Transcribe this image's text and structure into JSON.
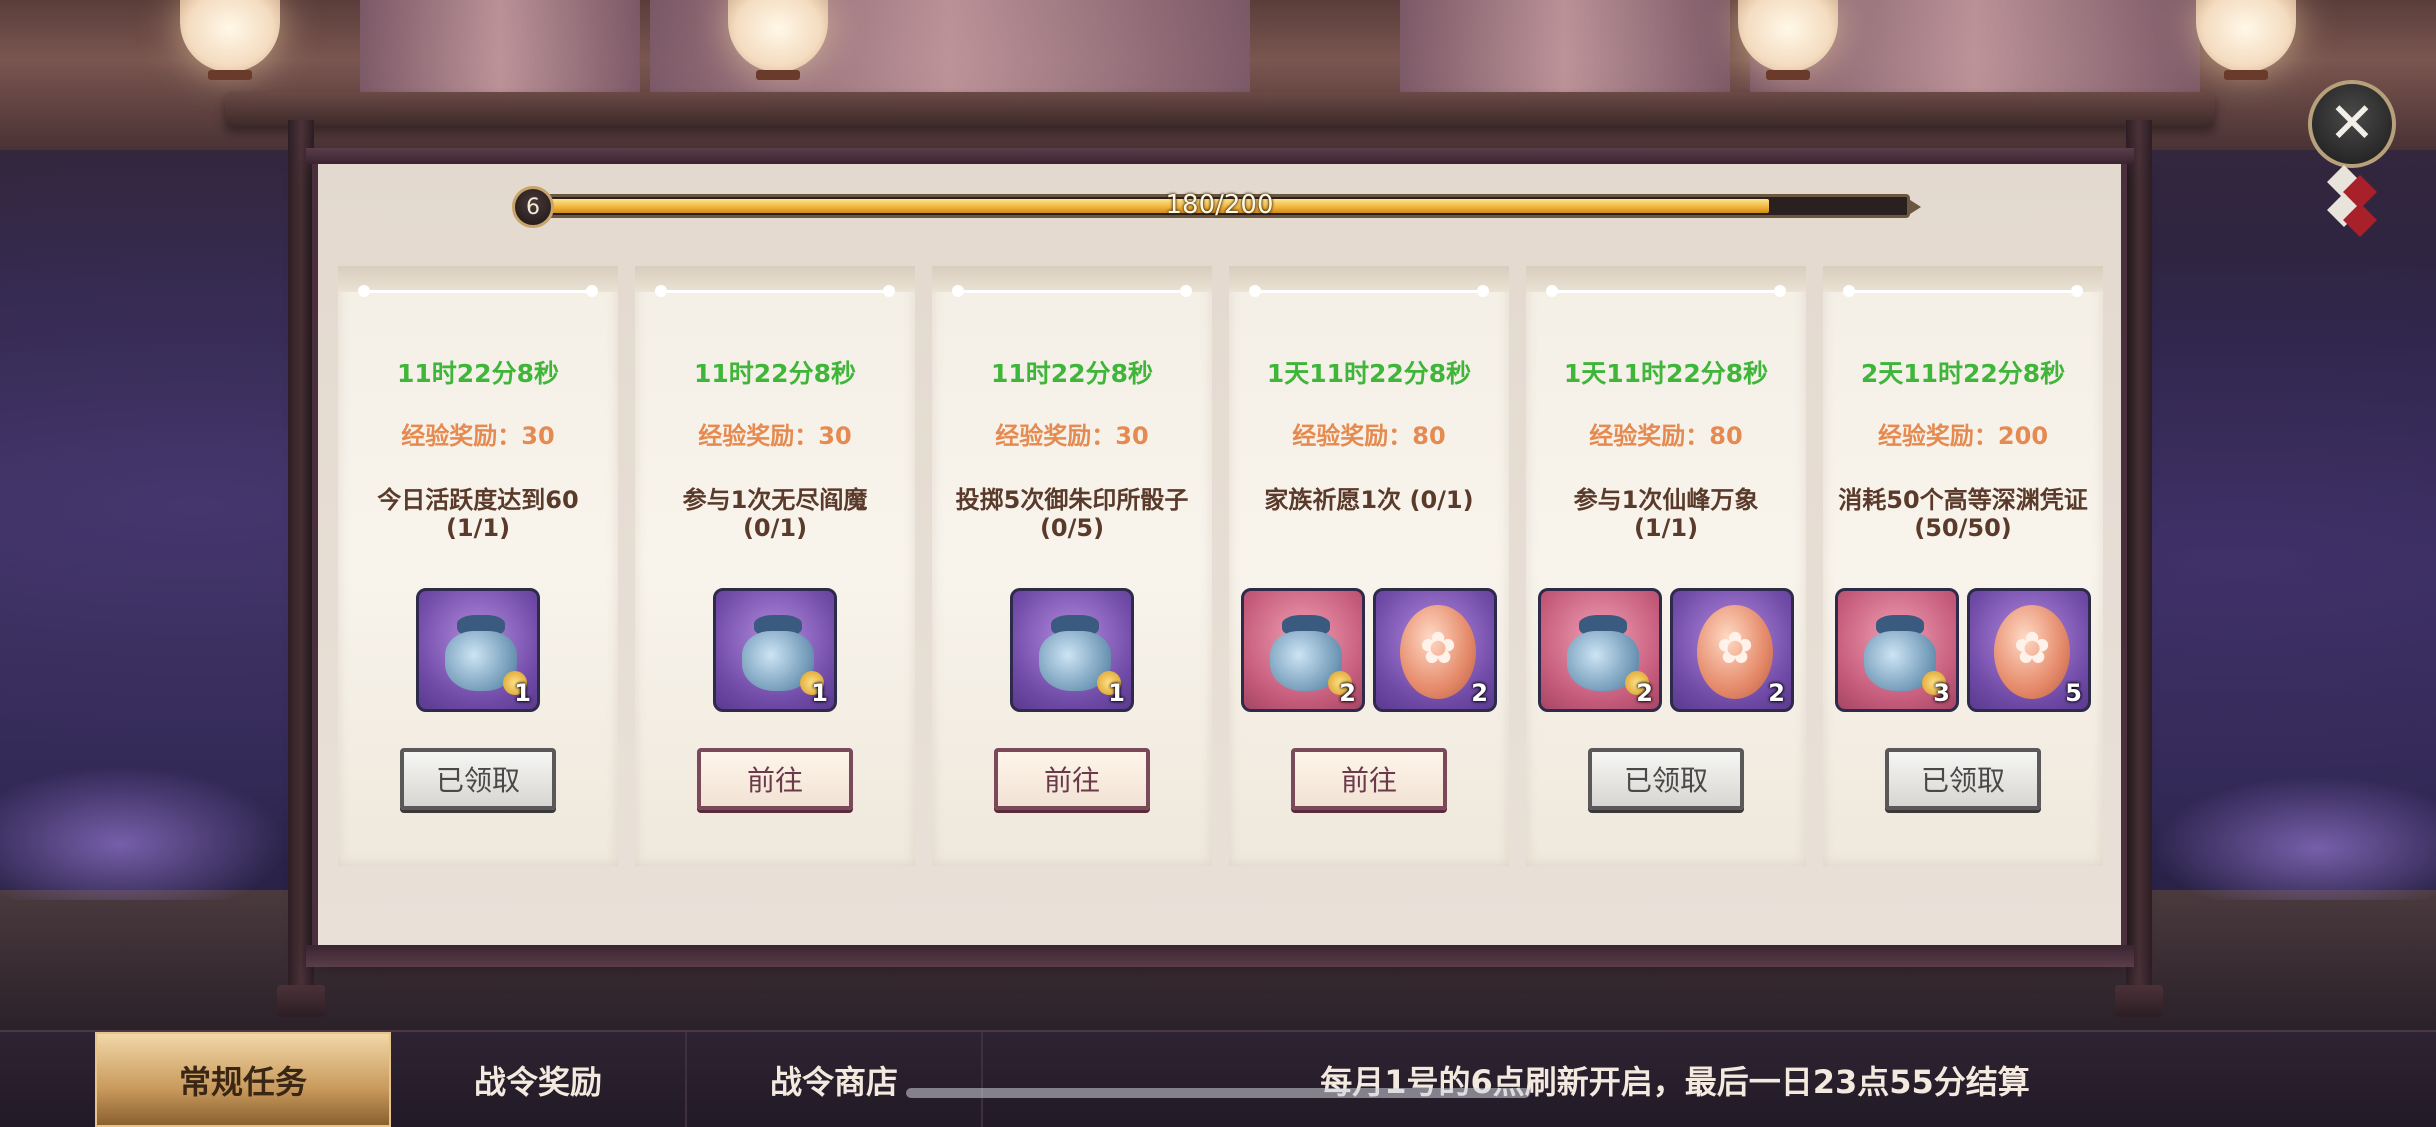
{
  "progress": {
    "level": "6",
    "text": "180/200",
    "fraction": 0.9
  },
  "close_icon": "close-x-icon",
  "cards": [
    {
      "timer": "11时22分8秒",
      "exp": "经验奖励：30",
      "task": "今日活跃度达到60 (1/1)",
      "rewards": [
        {
          "icon": "bag-icon",
          "frame": "purple",
          "qty": "1"
        }
      ],
      "button": "已领取",
      "button_state": "claimed"
    },
    {
      "timer": "11时22分8秒",
      "exp": "经验奖励：30",
      "task": "参与1次无尽阎魔 (0/1)",
      "rewards": [
        {
          "icon": "bag-icon",
          "frame": "purple",
          "qty": "1"
        }
      ],
      "button": "前往",
      "button_state": "goto"
    },
    {
      "timer": "11时22分8秒",
      "exp": "经验奖励：30",
      "task": "投掷5次御朱印所骰子 (0/5)",
      "rewards": [
        {
          "icon": "bag-icon",
          "frame": "purple",
          "qty": "1"
        }
      ],
      "button": "前往",
      "button_state": "goto"
    },
    {
      "timer": "1天11时22分8秒",
      "exp": "经验奖励：80",
      "task": "家族祈愿1次 (0/1)",
      "rewards": [
        {
          "icon": "bag-icon",
          "frame": "pink",
          "qty": "2"
        },
        {
          "icon": "egg-icon",
          "frame": "purple",
          "qty": "2"
        }
      ],
      "button": "前往",
      "button_state": "goto"
    },
    {
      "timer": "1天11时22分8秒",
      "exp": "经验奖励：80",
      "task": "参与1次仙峰万象 (1/1)",
      "rewards": [
        {
          "icon": "bag-icon",
          "frame": "pink",
          "qty": "2"
        },
        {
          "icon": "egg-icon",
          "frame": "purple",
          "qty": "2"
        }
      ],
      "button": "已领取",
      "button_state": "claimed"
    },
    {
      "timer": "2天11时22分8秒",
      "exp": "经验奖励：200",
      "task": "消耗50个高等深渊凭证 (50/50)",
      "rewards": [
        {
          "icon": "bag-icon",
          "frame": "pink",
          "qty": "3"
        },
        {
          "icon": "egg-icon",
          "frame": "purple",
          "qty": "5"
        }
      ],
      "button": "已领取",
      "button_state": "claimed"
    }
  ],
  "tabs": [
    {
      "label": "常规任务",
      "active": true
    },
    {
      "label": "战令奖励",
      "active": false
    },
    {
      "label": "战令商店",
      "active": false
    }
  ],
  "notice": "每月1号的6点刷新开启，最后一日23点55分结算",
  "colors": {
    "timer": "#3fb53a",
    "exp": "#e58a50",
    "progress_fill": "#f0b23c",
    "reward_purple": "#6f4aa6",
    "reward_pink": "#c45a7a"
  }
}
